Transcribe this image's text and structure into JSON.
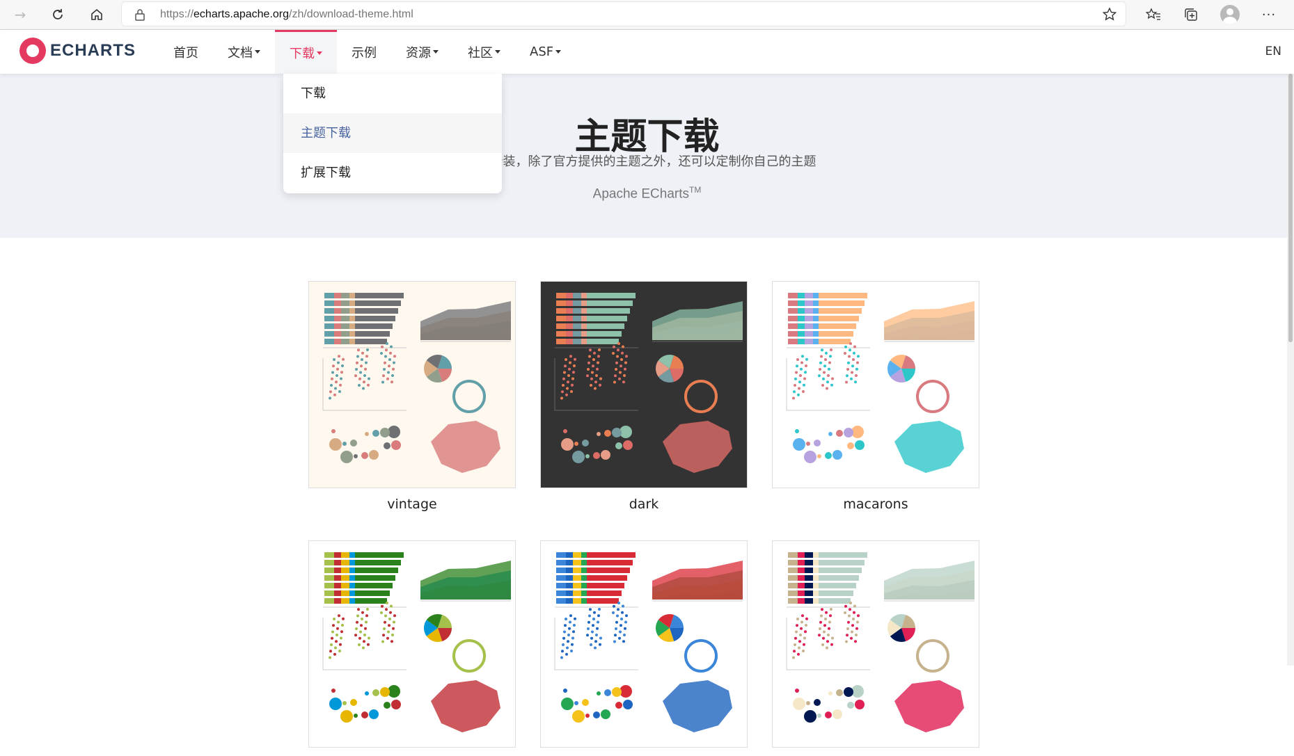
{
  "browser": {
    "url_prefix": "https://",
    "url_domain": "echarts.apache.org",
    "url_path": "/zh/download-theme.html"
  },
  "site": {
    "logo_text": "ECHARTS",
    "nav": [
      {
        "label": "首页",
        "dropdown": false
      },
      {
        "label": "文档",
        "dropdown": true
      },
      {
        "label": "下载",
        "dropdown": true,
        "active": true
      },
      {
        "label": "示例",
        "dropdown": false
      },
      {
        "label": "资源",
        "dropdown": true
      },
      {
        "label": "社区",
        "dropdown": true
      },
      {
        "label": "ASF",
        "dropdown": true
      }
    ],
    "lang": "EN",
    "accent": "#e43961"
  },
  "dropdown": {
    "items": [
      "下载",
      "主题下载",
      "扩展下载"
    ],
    "highlighted": "主题下载"
  },
  "hero": {
    "title": "主题下载",
    "subtitle": "换个装，除了官方提供的主题之外，还可以定制你自己的主题",
    "brand": "Apache ECharts",
    "brand_sup": "TM"
  },
  "themes": [
    {
      "name": "vintage",
      "bg": "#fef8ef",
      "colors": [
        "#d87c7c",
        "#919e8b",
        "#d7ab82",
        "#6e7074",
        "#61a0a8"
      ]
    },
    {
      "name": "dark",
      "bg": "#333333",
      "colors": [
        "#dd6b66",
        "#759aa0",
        "#e69d87",
        "#8dc1a9",
        "#ea7e53"
      ]
    },
    {
      "name": "macarons",
      "bg": "#ffffff",
      "colors": [
        "#2ec7c9",
        "#b6a2de",
        "#5ab1ef",
        "#ffb980",
        "#d87a80"
      ]
    },
    {
      "name": "",
      "bg": "#ffffff",
      "colors": [
        "#c12e34",
        "#e6b600",
        "#0098d9",
        "#2b821d",
        "#a5c04b"
      ]
    },
    {
      "name": "",
      "bg": "#ffffff",
      "colors": [
        "#1e64c1",
        "#f4c21b",
        "#24a652",
        "#d92b35",
        "#3b86d8"
      ]
    },
    {
      "name": "",
      "bg": "#ffffff",
      "colors": [
        "#e01f54",
        "#001852",
        "#f5e8c8",
        "#b8d2c7",
        "#c6b38e"
      ]
    }
  ]
}
